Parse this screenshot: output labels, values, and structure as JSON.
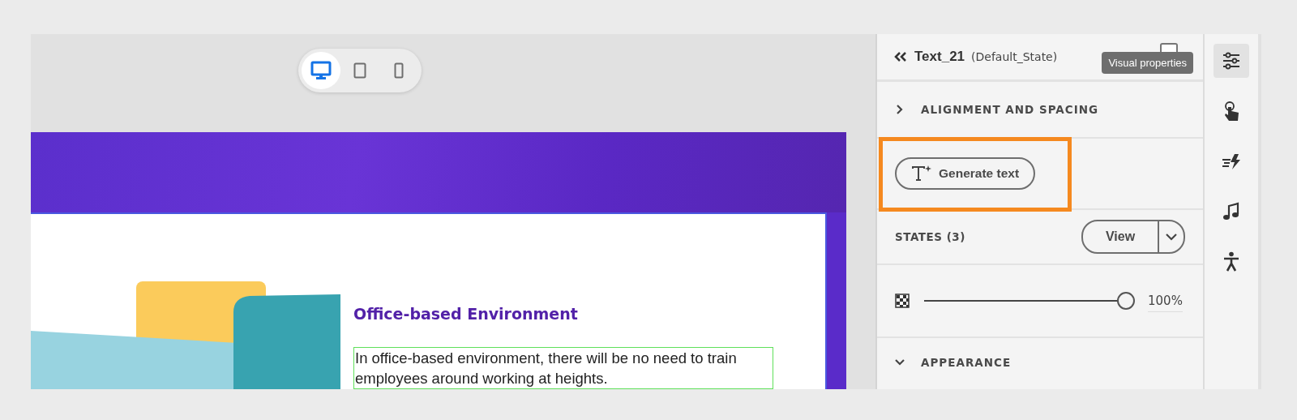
{
  "device_toggle": [
    {
      "kind": "desktop",
      "selected": true
    },
    {
      "kind": "tablet",
      "selected": false
    },
    {
      "kind": "phone",
      "selected": false
    }
  ],
  "slide": {
    "title": "Office-based Environment",
    "body": "In office-based environment, there will be no need to train employees around working at heights.",
    "body_selected": true
  },
  "panel": {
    "title": "Text_21",
    "state": "(Default_State)",
    "tooltip": "Visual properties",
    "alignment": {
      "label": "ALIGNMENT AND SPACING",
      "expanded": false
    },
    "generate_button": "Generate text",
    "highlighted": true,
    "states": {
      "label": "STATES (3)",
      "button": "View"
    },
    "opacity": {
      "level": 1,
      "reading": "100%"
    },
    "appearance": {
      "label": "APPEARANCE",
      "expanded": true
    }
  },
  "rail": [
    {
      "kind": "properties",
      "selected": true
    },
    {
      "kind": "interaction",
      "selected": false
    },
    {
      "kind": "effects",
      "selected": false
    },
    {
      "kind": "audio",
      "selected": false
    },
    {
      "kind": "accessibility",
      "selected": false
    }
  ]
}
